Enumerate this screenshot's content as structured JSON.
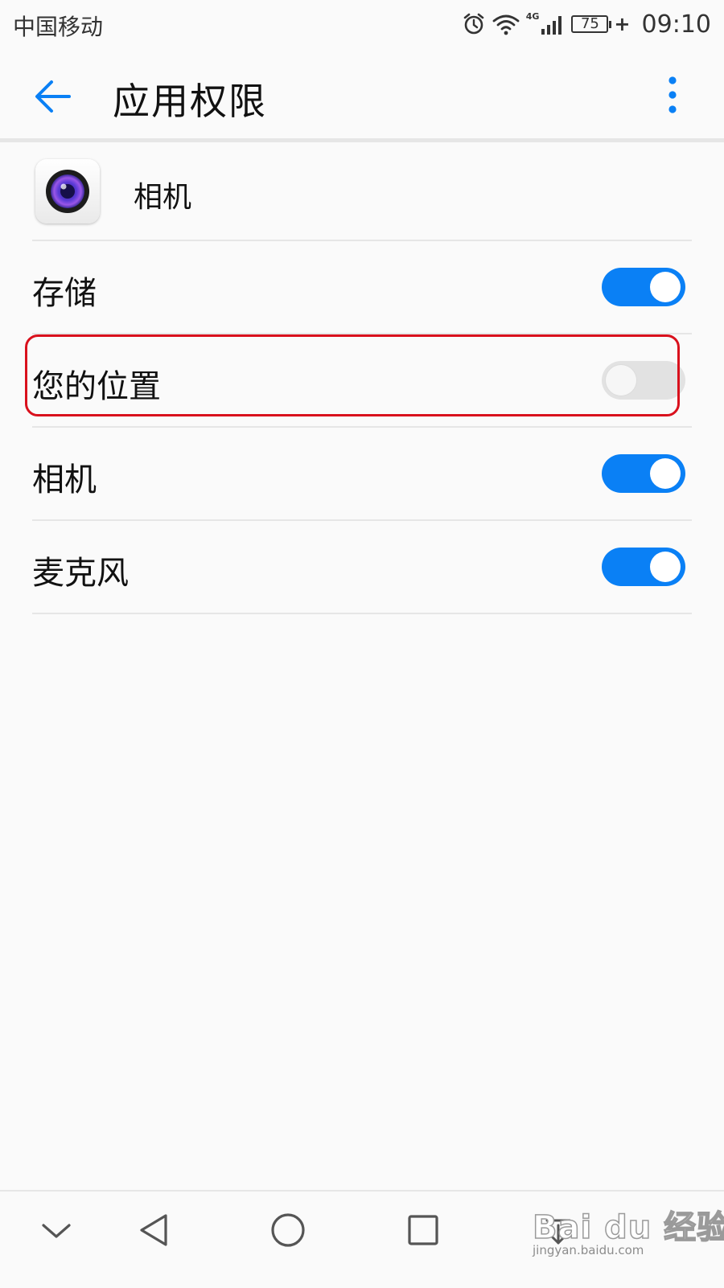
{
  "status_bar": {
    "carrier": "中国移动",
    "network_label": "4G",
    "battery": "75",
    "time": "09:10",
    "icons": [
      "alarm-icon",
      "wifi-icon",
      "signal-icon",
      "battery-icon",
      "charging-icon"
    ]
  },
  "app_bar": {
    "title": "应用权限",
    "back_icon": "arrow-left-icon",
    "menu_icon": "more-vertical-icon"
  },
  "app": {
    "name": "相机",
    "icon": "camera-app-icon"
  },
  "permissions": [
    {
      "label": "存储",
      "enabled": true
    },
    {
      "label": "您的位置",
      "enabled": false
    },
    {
      "label": "相机",
      "enabled": true
    },
    {
      "label": "麦克风",
      "enabled": true
    }
  ],
  "colors": {
    "accent": "#0a80f5",
    "toggle_off": "#e2e2e2",
    "highlight": "#d9111d",
    "background": "#fafafa"
  },
  "nav_bar": {
    "icons": [
      "chevron-down-icon",
      "back-triangle-icon",
      "home-circle-icon",
      "recents-square-icon",
      "notification-pull-icon"
    ]
  },
  "watermark": {
    "brand": "Bai du 经验",
    "url": "jingyan.baidu.com"
  }
}
